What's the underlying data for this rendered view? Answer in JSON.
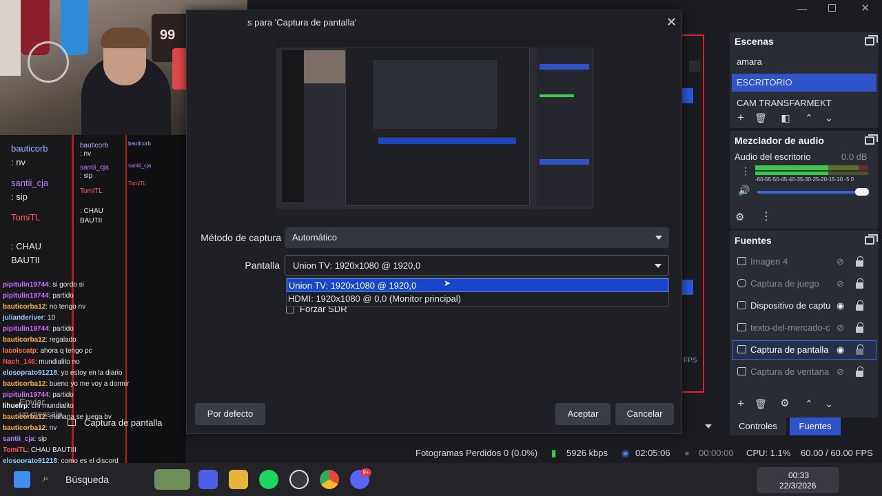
{
  "window": {
    "title_fragment": "s para 'Captura de pantalla'"
  },
  "webcam": {
    "jersey_number": "99"
  },
  "chat": {
    "messages": [
      {
        "user": "bauticorb",
        "text": ": nv",
        "color": "#a7b6ff"
      },
      {
        "user": "santii_cja",
        "text": ": sip",
        "color": "#c07cff"
      },
      {
        "user": "TomiTL",
        "text": ": CHAU BAUTII",
        "color": "#ff5a5a"
      },
      {
        "user": "pipitulin19744",
        "text": ": si gordo si",
        "color": "#d06cff"
      },
      {
        "user": "pipitulin19744",
        "text": ": partido",
        "color": "#d06cff"
      },
      {
        "user": "bauticorba12",
        "text": ": no tengo nv",
        "color": "#ffb13b"
      },
      {
        "user": "julianderiver",
        "text": ": 10",
        "color": "#9cc3ff"
      },
      {
        "user": "bauticorba12",
        "text": ": regalado",
        "color": "#ffb13b"
      },
      {
        "user": "lacolscatp",
        "text": ": ahora q tengo pc",
        "color": "#ff7b3b"
      },
      {
        "user": "Nach_146",
        "text": ": mundialito no",
        "color": "#ff4a4a"
      },
      {
        "user": "elosoprato91218",
        "text": ": yo estoy en la diario",
        "color": "#8fd4ff"
      },
      {
        "user": "bauticorba12",
        "text": ": bueno yo me voy a dormir",
        "color": "#ffb13b"
      },
      {
        "user": "pipitulin19744",
        "text": ": partido",
        "color": "#d06cff"
      },
      {
        "user": "lihuelrp",
        "text": ": chi mundialito",
        "color": "#ffffff"
      },
      {
        "user": "bauticorba12",
        "text": ": mañana se juega bv",
        "color": "#ffb13b"
      },
      {
        "user": "bauticorba12",
        "text": ": nv",
        "color": "#ffb13b"
      },
      {
        "user": "santii_cja",
        "text": ": sip",
        "color": "#c07cff"
      },
      {
        "user": "TomiTL",
        "text": ": CHAU BAUTIII",
        "color": "#ff5a5a"
      },
      {
        "user": "elosoprato91218",
        "text": ": como es el discord",
        "color": "#8fd4ff"
      }
    ],
    "big_lines": [
      {
        "user": "bauticorb",
        "text": ": nv"
      },
      {
        "user": "santii_cja",
        "text": ": sip"
      },
      {
        "user": "TomiTL",
        "text": ": CHAU BAUTII"
      }
    ],
    "overlay_texts": {
      "enviar": "Enviar",
      "un_mensaje": "un mensaje",
      "capture_label": "Captura de pantalla",
      "busqueda": "Búsqueda"
    }
  },
  "dialog": {
    "title": "s para 'Captura de pantalla'",
    "capture_method_label": "Método de captura",
    "capture_method_value": "Automático",
    "screen_label": "Pantalla",
    "screen_value": "Union TV: 1920x1080 @ 1920,0",
    "screen_options": [
      "Union TV: 1920x1080 @ 1920,0",
      "HDMI: 1920x1080 @ 0,0 (Monitor principal)"
    ],
    "sdr_label": "Forzar SDR",
    "defaults_button": "Por defecto",
    "accept_button": "Aceptar",
    "cancel_button": "Cancelar"
  },
  "scenes": {
    "title": "Escenas",
    "items": [
      "amara",
      "ESCRITORIO",
      "CAM TRANSFARMEKT"
    ],
    "selected": "ESCRITORIO"
  },
  "audio_mixer": {
    "title": "Mezclador de audio",
    "channel_name": "Audio del escritorio",
    "level": "0.0 dB",
    "scale": "-60-55-50-45-40-35-30-25-20-15-10 -5 0"
  },
  "sources": {
    "title": "Fuentes",
    "items": [
      {
        "label": "Imagen 4",
        "visible": false
      },
      {
        "label": "Captura de juego",
        "visible": false
      },
      {
        "label": "Dispositivo de captu",
        "visible": true
      },
      {
        "label": "texto-del-mercado-c",
        "visible": false
      },
      {
        "label": "Captura de pantalla",
        "visible": true
      },
      {
        "label": "Captura de ventana",
        "visible": false
      }
    ],
    "selected": "Captura de pantalla"
  },
  "tabs": {
    "controls": "Controles",
    "sources": "Fuentes"
  },
  "status": {
    "dropped_frames": "Fotogramas Perdidos 0 (0.0%)",
    "bitrate": "5926 kbps",
    "stream_time": "02:05:06",
    "rec_time": "00:00:00",
    "cpu": "CPU: 1.1%",
    "fps": "60.00 / 60.00 FPS"
  },
  "taskbar": {
    "search_placeholder": "Búsqueda",
    "time": "00:33",
    "date": "22/3/2026",
    "discord_badge": "9+"
  },
  "colors": {
    "accent": "#2f53c9",
    "dropdown_selected": "#1846c8",
    "meter_green": "#3cc84a",
    "obs_red_border": "#e0202a"
  }
}
